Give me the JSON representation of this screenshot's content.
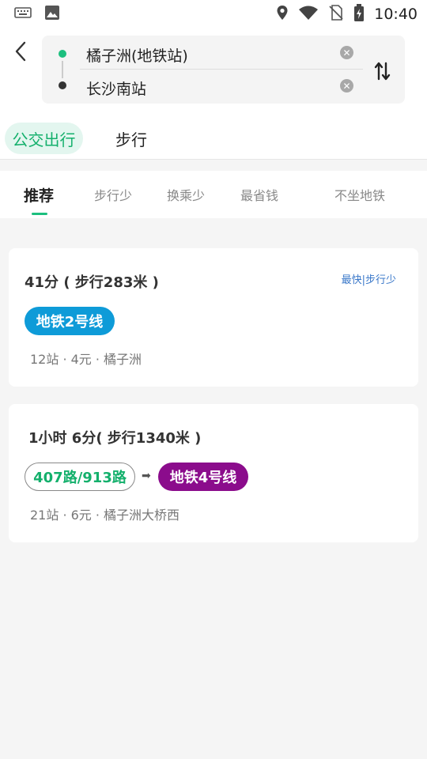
{
  "status_bar": {
    "time": "10:40",
    "icons": [
      "keyboard-icon",
      "image-icon",
      "location-icon",
      "wifi-icon",
      "no-sim-icon",
      "battery-charging-icon"
    ]
  },
  "route": {
    "from": "橘子洲(地铁站)",
    "to": "长沙南站",
    "colors": {
      "start_dot": "#1cbf7e",
      "end_dot": "#333333"
    }
  },
  "mode_tabs": [
    {
      "label": "公交出行",
      "active": true
    },
    {
      "label": "步行",
      "active": false
    }
  ],
  "filters": [
    {
      "label": "推荐",
      "active": true
    },
    {
      "label": "步行少",
      "active": false
    },
    {
      "label": "换乘少",
      "active": false
    },
    {
      "label": "最省钱",
      "active": false
    },
    {
      "label": "不坐地铁",
      "active": false
    }
  ],
  "results": [
    {
      "title": "41分 ( 步行283米 )",
      "tag": "最快|步行少",
      "lines": [
        {
          "label": "地铁2号线",
          "style": "blue",
          "color": "#0e9bd8"
        }
      ],
      "meta": "12站 · 4元 · 橘子洲"
    },
    {
      "title": "1小时  6分( 步行1340米 )",
      "lines": [
        {
          "label": "407路/913路",
          "style": "outline",
          "color": "#14b06c"
        },
        {
          "label": "地铁4号线",
          "style": "purple",
          "color": "#8b0c8c"
        }
      ],
      "meta": "21站 · 6元 · 橘子洲大桥西"
    }
  ]
}
